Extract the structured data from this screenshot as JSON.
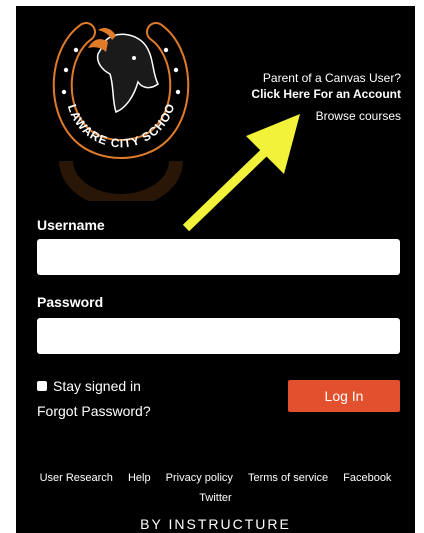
{
  "logo": {
    "text": "DELAWARE CITY SCHOOLS"
  },
  "parent": {
    "question": "Parent of a Canvas User?",
    "link": "Click Here For an Account",
    "browse": "Browse courses"
  },
  "form": {
    "username_label": "Username",
    "password_label": "Password",
    "stay_signed_in": "Stay signed in",
    "forgot_password": "Forgot Password?",
    "login_button": "Log In"
  },
  "footer": {
    "links": [
      "User Research",
      "Help",
      "Privacy policy",
      "Terms of service",
      "Facebook",
      "Twitter"
    ]
  },
  "brand": "BY INSTRUCTURE",
  "colors": {
    "background": "#000000",
    "accent": "#e3502d",
    "logo_ring": "#e07b2a",
    "arrow": "#f3f23a"
  }
}
